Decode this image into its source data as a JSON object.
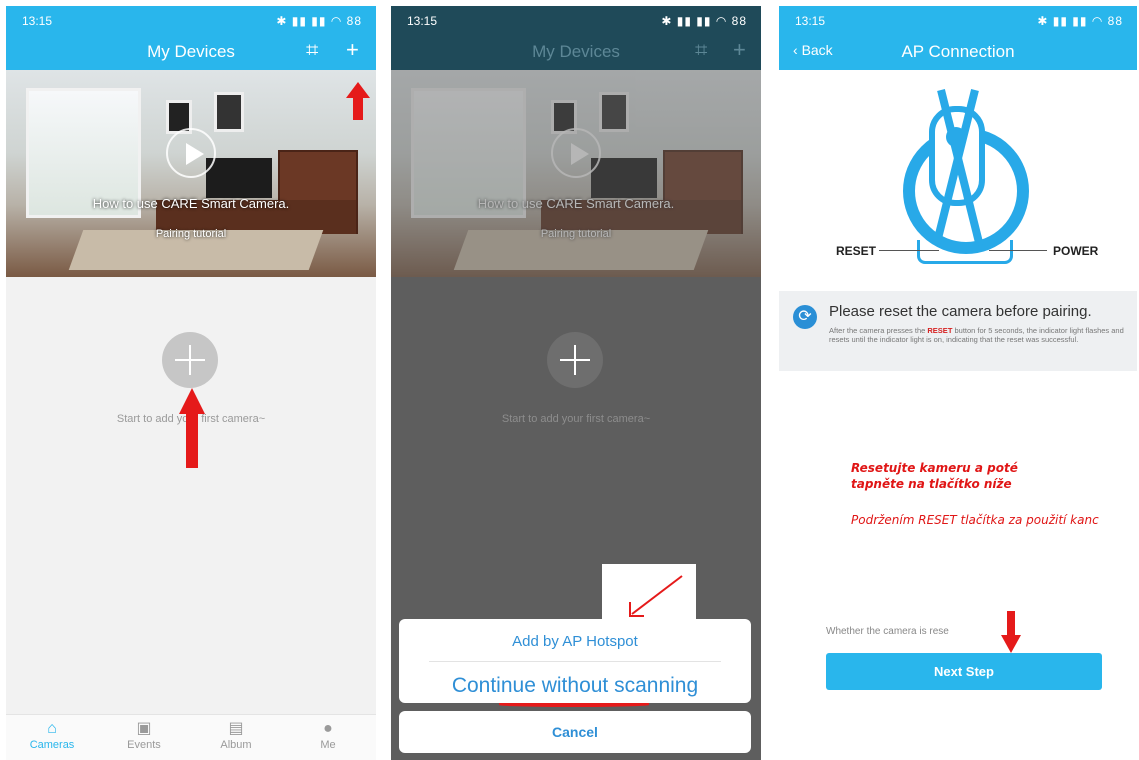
{
  "status": {
    "time": "13:15",
    "battery": "88"
  },
  "colors": {
    "brand": "#29b6ec",
    "arrow": "#e51a1a",
    "link": "#2f8fd6"
  },
  "screen1": {
    "title": "My Devices",
    "banner_title": "How to use CARE Smart Camera.",
    "banner_subtitle": "Pairing tutorial",
    "empty_text": "Start to add your first camera~",
    "nav": [
      {
        "label": "Cameras",
        "icon": "home-icon"
      },
      {
        "label": "Events",
        "icon": "chat-icon"
      },
      {
        "label": "Album",
        "icon": "album-icon"
      },
      {
        "label": "Me",
        "icon": "person-icon"
      }
    ]
  },
  "screen2": {
    "title": "My Devices",
    "banner_title": "How to use CARE Smart Camera.",
    "banner_subtitle": "Pairing tutorial",
    "empty_text": "Start to add your first camera~",
    "option1": "Add by AP Hotspot",
    "option2": "Continue without scanning",
    "cancel": "Cancel"
  },
  "screen3": {
    "back": "Back",
    "title": "AP Connection",
    "reset_label": "RESET",
    "power_label": "POWER",
    "info_heading": "Please reset the camera before pairing.",
    "info_body_pre": "After the camera presses the ",
    "info_body_key": "RESET",
    "info_body_post": " button for 5 seconds, the indicator light flashes and resets until the indicator light is on, indicating that the reset was successful.",
    "note_line1": "Resetujte kameru a poté",
    "note_line2": "tapněte na tlačítko níže",
    "note_line3": "Podržením RESET tlačítka za použití kanc",
    "whether": "Whether the camera is rese",
    "next": "Next Step"
  }
}
